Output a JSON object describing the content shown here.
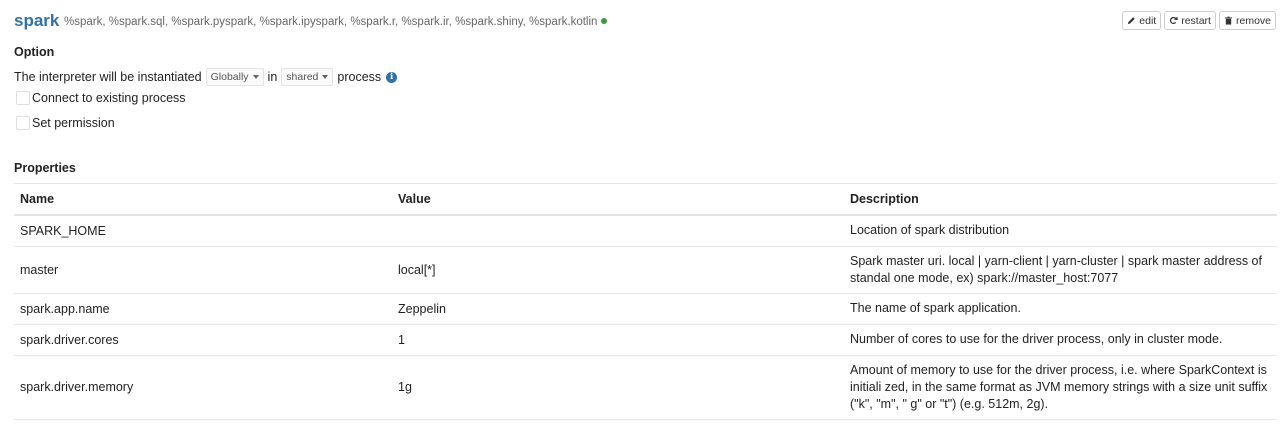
{
  "header": {
    "name": "spark",
    "aliases": "%spark, %spark.sql, %spark.pyspark, %spark.ipyspark, %spark.r, %spark.ir, %spark.shiny, %spark.kotlin",
    "status_color": "#3c9b3c",
    "buttons": {
      "edit": "edit",
      "restart": "restart",
      "remove": "remove"
    }
  },
  "option": {
    "title": "Option",
    "line_prefix": "The interpreter will be instantiated",
    "scope_selected": "Globally",
    "connector": "in",
    "mode_selected": "shared",
    "line_suffix": "process",
    "connect_existing_label": "Connect to existing process",
    "set_permission_label": "Set permission"
  },
  "properties": {
    "title": "Properties",
    "columns": [
      "Name",
      "Value",
      "Description"
    ],
    "rows": [
      {
        "name": "SPARK_HOME",
        "value": "",
        "description": "Location of spark distribution"
      },
      {
        "name": "master",
        "value": "local[*]",
        "description": "Spark master uri. local | yarn-client | yarn-cluster | spark master address of standal one mode, ex) spark://master_host:7077"
      },
      {
        "name": "spark.app.name",
        "value": "Zeppelin",
        "description": "The name of spark application."
      },
      {
        "name": "spark.driver.cores",
        "value": "1",
        "description": "Number of cores to use for the driver process, only in cluster mode."
      },
      {
        "name": "spark.driver.memory",
        "value": "1g",
        "description": "Amount of memory to use for the driver process, i.e. where SparkContext is initiali zed, in the same format as JVM memory strings with a size unit suffix (\"k\", \"m\", \" g\" or \"t\") (e.g. 512m, 2g)."
      }
    ]
  },
  "colors": {
    "accent": "#3071a9",
    "status_running": "#3c9b3c"
  }
}
